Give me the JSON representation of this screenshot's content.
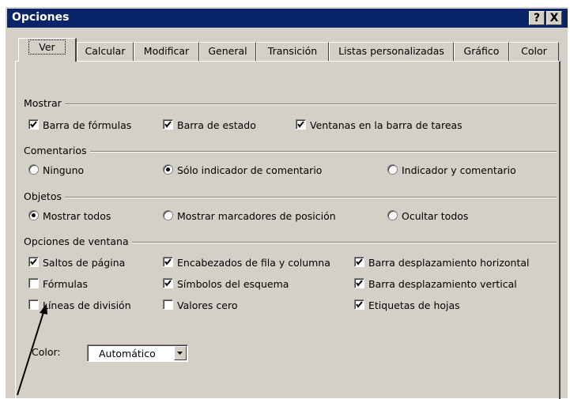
{
  "window": {
    "title": "Opciones",
    "help_button": "?",
    "close_button": "X"
  },
  "tabs": [
    "Ver",
    "Calcular",
    "Modificar",
    "General",
    "Transición",
    "Listas personalizadas",
    "Gráfico",
    "Color"
  ],
  "active_tab": "Ver",
  "groups": {
    "mostrar": {
      "label": "Mostrar",
      "items": [
        {
          "label": "Barra de fórmulas",
          "checked": true
        },
        {
          "label": "Barra de estado",
          "checked": true
        },
        {
          "label": "Ventanas en la barra de tareas",
          "checked": true
        }
      ]
    },
    "comentarios": {
      "label": "Comentarios",
      "options": [
        {
          "label": "Ninguno",
          "selected": false
        },
        {
          "label": "Sólo indicador de comentario",
          "selected": true
        },
        {
          "label": "Indicador y comentario",
          "selected": false
        }
      ]
    },
    "objetos": {
      "label": "Objetos",
      "options": [
        {
          "label": "Mostrar todos",
          "selected": true
        },
        {
          "label": "Mostrar marcadores de posición",
          "selected": false
        },
        {
          "label": "Ocultar todos",
          "selected": false
        }
      ]
    },
    "ventana": {
      "label": "Opciones de ventana",
      "items": [
        {
          "label": "Saltos de página",
          "checked": true
        },
        {
          "label": "Encabezados de fila y columna",
          "checked": true
        },
        {
          "label": "Barra desplazamiento horizontal",
          "checked": true
        },
        {
          "label": "Fórmulas",
          "checked": false
        },
        {
          "label": "Símbolos del esquema",
          "checked": true
        },
        {
          "label": "Barra desplazamiento vertical",
          "checked": true
        },
        {
          "label": "Líneas de división",
          "checked": false
        },
        {
          "label": "Valores cero",
          "checked": false
        },
        {
          "label": "Etiquetas de hojas",
          "checked": true
        }
      ]
    }
  },
  "color": {
    "label": "Color:",
    "value": "Automático"
  },
  "colors": {
    "titlebar": "#0a246a",
    "face": "#d4d0c8"
  }
}
